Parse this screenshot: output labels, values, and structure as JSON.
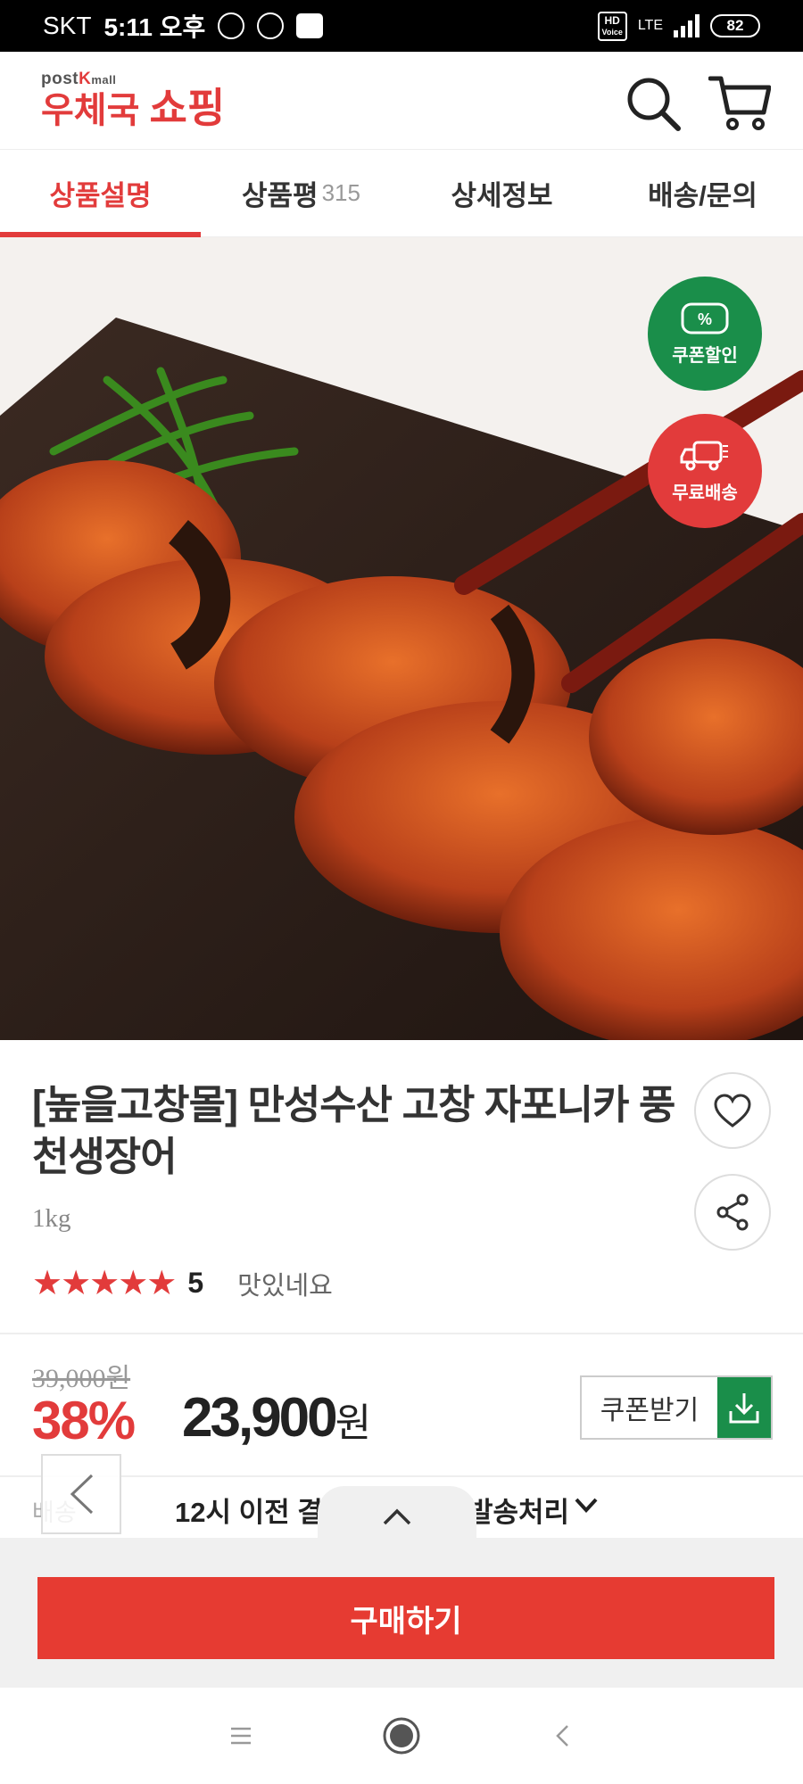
{
  "status_bar": {
    "carrier": "SKT",
    "time": "5:11 오후",
    "hd_label": "HD",
    "voice_label": "Voice",
    "lte_label": "LTE",
    "battery": "82"
  },
  "header": {
    "logo_small": "post",
    "logo_k": "K",
    "logo_mall": "mall",
    "logo_main": "우체국",
    "logo_shop": "쇼핑"
  },
  "tabs": [
    {
      "label": "상품설명",
      "count": ""
    },
    {
      "label": "상품평",
      "count": "315"
    },
    {
      "label": "상세정보",
      "count": ""
    },
    {
      "label": "배송/문의",
      "count": ""
    }
  ],
  "badges": {
    "coupon": "쿠폰할인",
    "coupon_symbol": "%",
    "free_shipping": "무료배송"
  },
  "product": {
    "title": "[높을고창몰] 만성수산 고창 자포니카 풍천생장어",
    "weight": "1kg",
    "stars": "★★★★★",
    "rating": "5",
    "review": "맛있네요",
    "original_price": "39,000원",
    "discount": "38%",
    "price": "23,900",
    "price_unit": "원",
    "coupon_label": "쿠폰받기"
  },
  "shipping": {
    "label": "배송",
    "text_a": "12시 이전 결제",
    "text_b": "발송처리"
  },
  "buy_button": "구매하기",
  "colors": {
    "brand_red": "#e23b3b",
    "green": "#1a8e4a",
    "buy_red": "#e63b32"
  }
}
